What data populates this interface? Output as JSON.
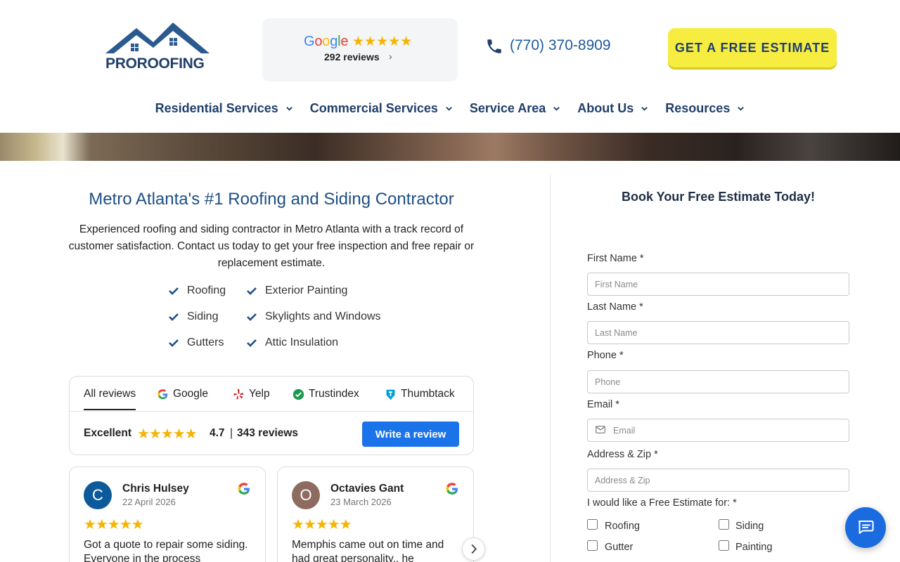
{
  "header": {
    "logo": {
      "text_pro": "PRO",
      "text_roofing": "ROOFING",
      "icon": "house-roof-icon"
    },
    "google_badge": {
      "word": "Google",
      "stars": "★★★★★",
      "count": "292 reviews",
      "chevron": "›"
    },
    "phone": "(770) 370-8909",
    "cta_label": "GET A FREE ESTIMATE"
  },
  "nav": {
    "items": [
      {
        "label": "Residential Services"
      },
      {
        "label": "Commercial Services"
      },
      {
        "label": "Service Area"
      },
      {
        "label": "About Us"
      },
      {
        "label": "Resources"
      }
    ]
  },
  "main": {
    "title": "Metro Atlanta's #1 Roofing and Siding Contractor",
    "description": "Experienced roofing and siding contractor in Metro Atlanta with a track record of customer satisfaction. Contact us today to get your free inspection and free repair or replacement estimate.",
    "services_col1": [
      "Roofing",
      "Siding",
      "Gutters"
    ],
    "services_col2": [
      "Exterior Painting",
      "Skylights and Windows",
      "Attic Insulation"
    ]
  },
  "reviews": {
    "tabs": [
      "All reviews",
      "Google",
      "Yelp",
      "Trustindex",
      "Thumbtack"
    ],
    "excellent": "Excellent",
    "stars": "★★★★★",
    "rating": "4.7",
    "separator": "|",
    "count": "343 reviews",
    "write_label": "Write a review",
    "cards": [
      {
        "initial": "C",
        "name": "Chris Hulsey",
        "date": "22 April 2026",
        "stars": "★★★★★",
        "text": "Got a quote to repair some siding. Everyone in the process",
        "avatar_color": "#0d5a9a"
      },
      {
        "initial": "O",
        "name": "Octavies Gant",
        "date": "23 March 2026",
        "stars": "★★★★★",
        "text": "Memphis came out on time and had great personality.. he",
        "avatar_color": "#8d6b5e"
      }
    ]
  },
  "form": {
    "title": "Book Your Free Estimate Today!",
    "first_name": {
      "label": "First Name *",
      "placeholder": "First Name"
    },
    "last_name": {
      "label": "Last Name *",
      "placeholder": "Last Name"
    },
    "phone": {
      "label": "Phone *",
      "placeholder": "Phone"
    },
    "email": {
      "label": "Email *",
      "placeholder": "Email"
    },
    "address": {
      "label": "Address & Zip *",
      "placeholder": "Address & Zip"
    },
    "estimate_label": "I would like a Free Estimate for: *",
    "options": [
      "Roofing",
      "Siding",
      "Gutter",
      "Painting"
    ]
  },
  "colors": {
    "brand_blue": "#1f3f6b",
    "cta_yellow": "#f7ec40",
    "link_blue": "#1d5a9c",
    "action_blue": "#1a73e8",
    "star": "#f5b400"
  }
}
